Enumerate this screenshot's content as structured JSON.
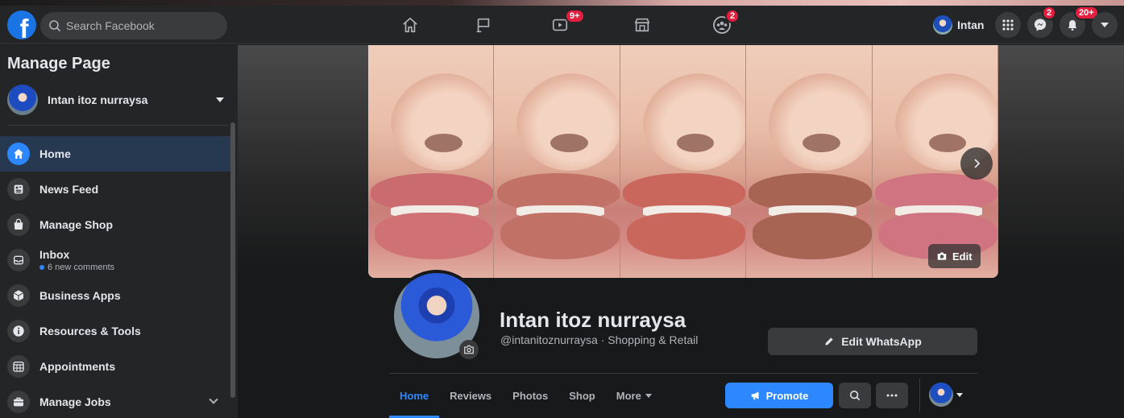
{
  "topbar": {
    "search_placeholder": "Search Facebook",
    "watch_badge": "9+",
    "groups_badge": "2",
    "user_name": "Intan",
    "messenger_badge": "2",
    "notifications_badge": "20+"
  },
  "sidebar": {
    "title": "Manage Page",
    "page_name": "Intan itoz nurraysa",
    "items": [
      {
        "label": "Home",
        "icon": "home-icon",
        "active": true
      },
      {
        "label": "News Feed",
        "icon": "news-feed-icon"
      },
      {
        "label": "Manage Shop",
        "icon": "shop-bag-icon"
      },
      {
        "label": "Inbox",
        "icon": "inbox-icon",
        "sub": "6 new comments"
      },
      {
        "label": "Business Apps",
        "icon": "cube-icon"
      },
      {
        "label": "Resources & Tools",
        "icon": "info-icon"
      },
      {
        "label": "Appointments",
        "icon": "calendar-icon"
      },
      {
        "label": "Manage Jobs",
        "icon": "briefcase-icon"
      }
    ]
  },
  "cover": {
    "edit_label": "Edit"
  },
  "profile": {
    "name": "Intan itoz nurraysa",
    "handle": "@intanitoznurraysa · Shopping & Retail",
    "whatsapp_label": "Edit WhatsApp"
  },
  "tabs": {
    "items": [
      "Home",
      "Reviews",
      "Photos",
      "Shop",
      "More"
    ],
    "promote_label": "Promote"
  },
  "colors": {
    "accent": "#2d88ff",
    "badge": "#e41e3f",
    "surface": "#242526",
    "background": "#18191a"
  }
}
